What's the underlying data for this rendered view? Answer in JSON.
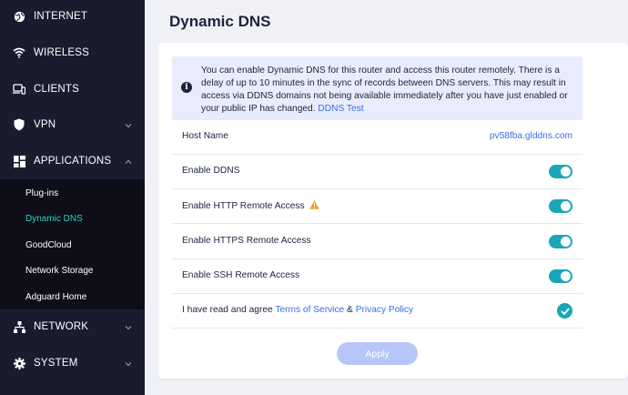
{
  "sidebar": {
    "items": [
      {
        "label": "INTERNET",
        "icon": "globe-icon"
      },
      {
        "label": "WIRELESS",
        "icon": "wifi-icon"
      },
      {
        "label": "CLIENTS",
        "icon": "devices-icon"
      },
      {
        "label": "VPN",
        "icon": "shield-icon"
      },
      {
        "label": "APPLICATIONS",
        "icon": "grid-icon"
      },
      {
        "label": "NETWORK",
        "icon": "network-icon"
      },
      {
        "label": "SYSTEM",
        "icon": "gear-icon"
      }
    ],
    "submenu": [
      "Plug-ins",
      "Dynamic DNS",
      "GoodCloud",
      "Network Storage",
      "Adguard Home"
    ],
    "active_sub": "Dynamic DNS",
    "accent": "#2ad3c4"
  },
  "page": {
    "title": "Dynamic DNS"
  },
  "notice": {
    "text": "You can enable Dynamic DNS for this router and access this router remotely. There is a delay of up to 10 minutes in the sync of records between DNS servers. This may result in access via DDNS domains not being available immediately after you have just enabled or your public IP has changed.",
    "link": "DDNS Test"
  },
  "settings": {
    "host_name_label": "Host Name",
    "host_name_value": "pv58fba.glddns.com",
    "enable_ddns": {
      "label": "Enable DDNS",
      "on": true
    },
    "enable_http": {
      "label": "Enable HTTP Remote Access",
      "on": true,
      "warning_icon": "warning-icon"
    },
    "enable_https": {
      "label": "Enable HTTPS Remote Access",
      "on": true
    },
    "enable_ssh": {
      "label": "Enable SSH Remote Access",
      "on": true
    },
    "agree": {
      "prefix": "I have read and agree",
      "terms": "Terms of Service",
      "amp": "&",
      "privacy": "Privacy Policy",
      "checked": true
    }
  },
  "apply_label": "Apply",
  "colors": {
    "toggle_on": "#1aa6b8",
    "link": "#3a6de4",
    "sidebar_bg": "#1a1c2e",
    "apply_disabled": "#b7c6f8"
  }
}
